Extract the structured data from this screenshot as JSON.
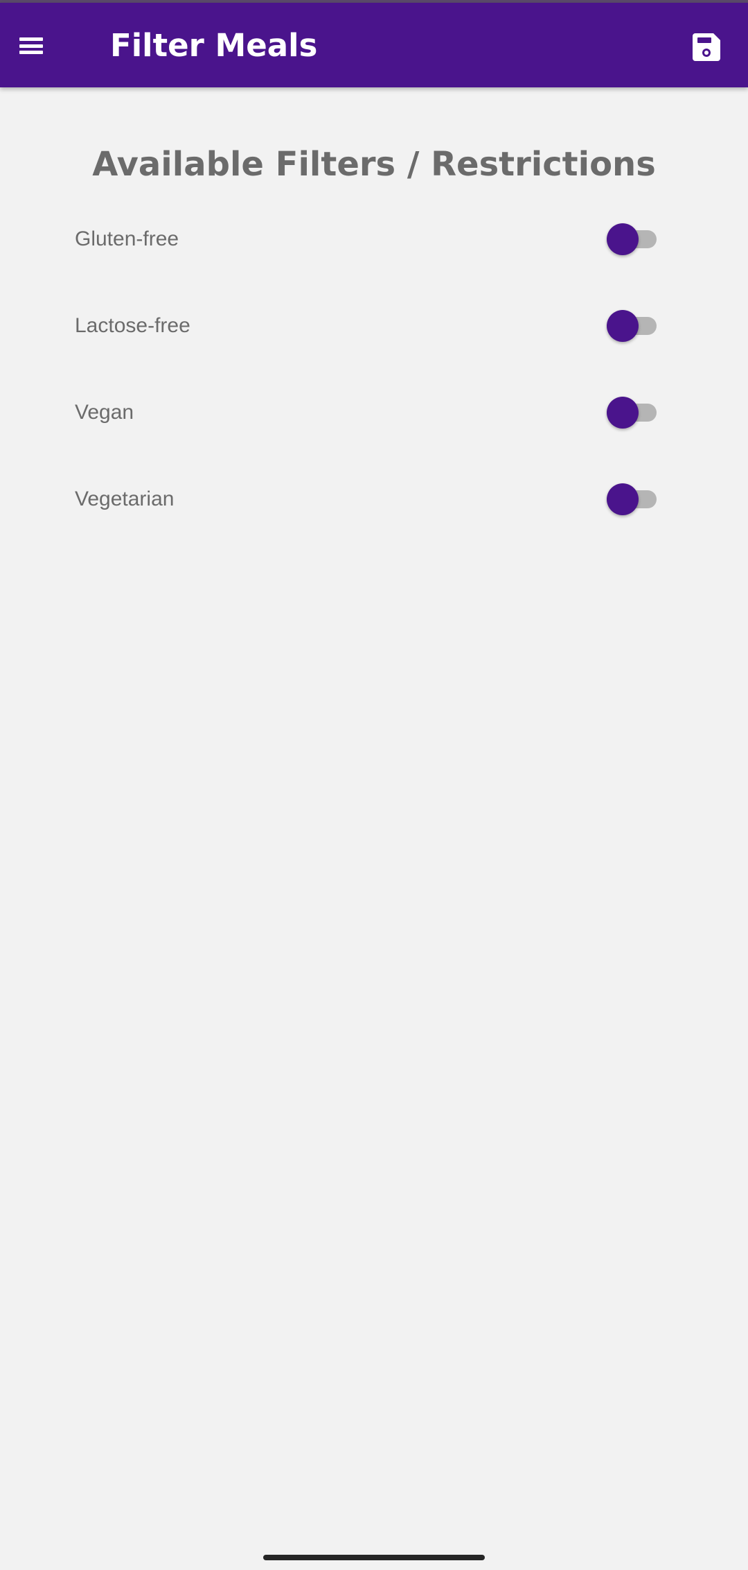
{
  "app_bar": {
    "title": "Filter Meals",
    "menu_icon": "menu-icon",
    "save_icon": "save-icon",
    "color": "#4a148c"
  },
  "main": {
    "heading": "Available Filters / Restrictions",
    "filters": [
      {
        "label": "Gluten-free",
        "enabled": false
      },
      {
        "label": "Lactose-free",
        "enabled": false
      },
      {
        "label": "Vegan",
        "enabled": false
      },
      {
        "label": "Vegetarian",
        "enabled": false
      }
    ]
  },
  "colors": {
    "accent": "#4a148c",
    "background": "#f2f2f2",
    "text": "#6b6b6b",
    "switch_track": "#b5b5b5"
  }
}
